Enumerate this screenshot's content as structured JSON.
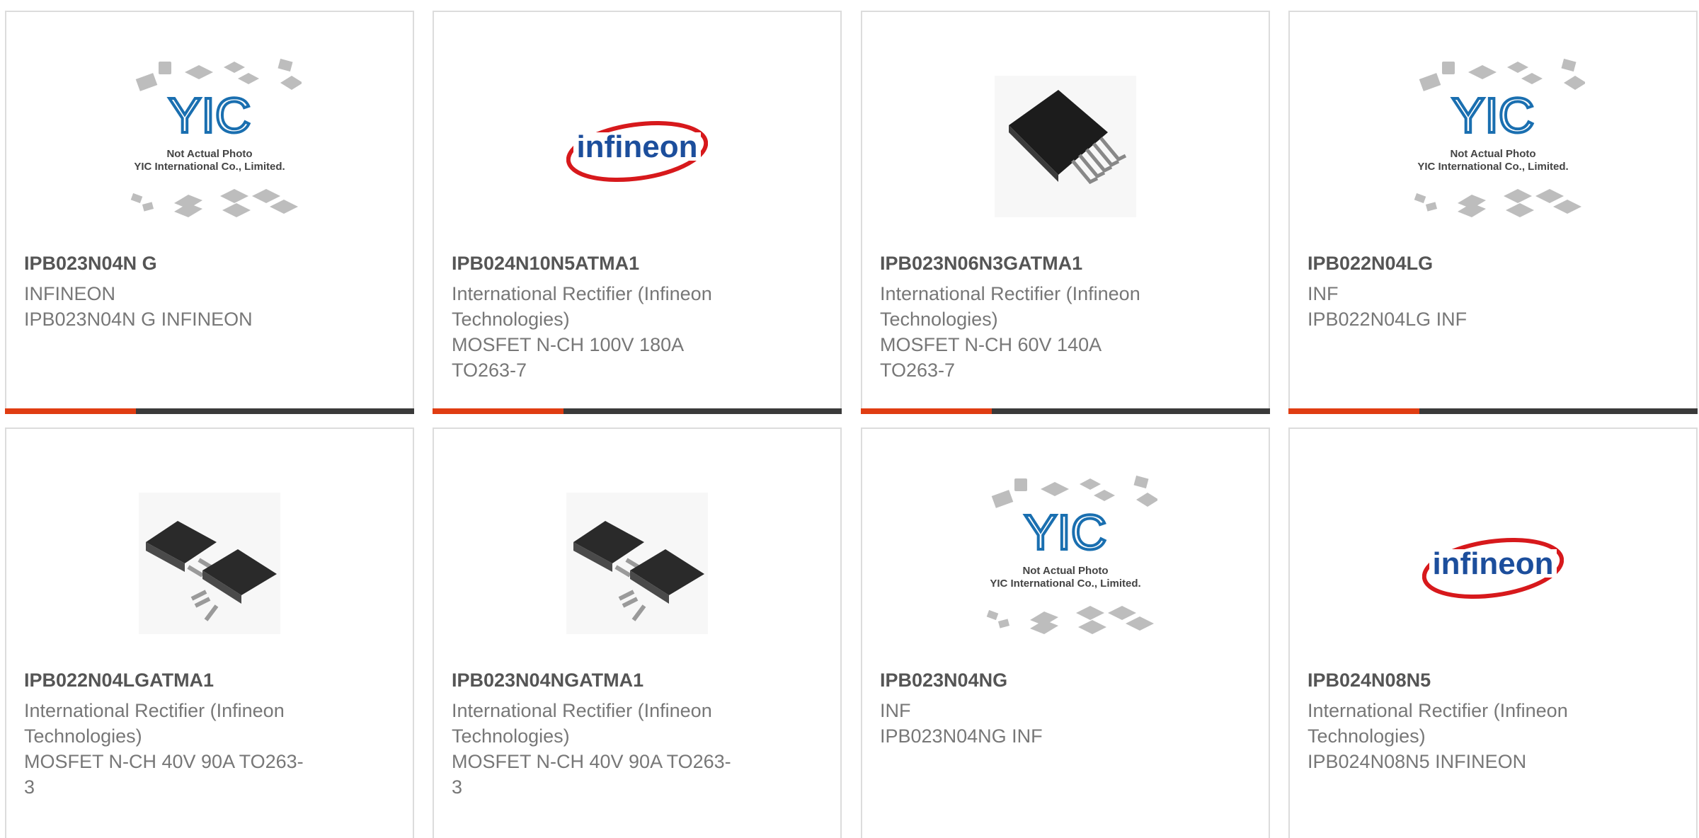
{
  "colors": {
    "accent": "#e03d12",
    "bar": "#3a3a3a",
    "title": "#555555",
    "text": "#777777",
    "border": "#dcdcdc"
  },
  "cards": [
    {
      "image": "yic-placeholder",
      "title": "IPB023N04N G",
      "lines": [
        "INFINEON",
        "IPB023N04N G INFINEON"
      ]
    },
    {
      "image": "infineon-logo",
      "title": "IPB024N10N5ATMA1",
      "lines": [
        "International Rectifier (Infineon",
        "Technologies)",
        "MOSFET N-CH 100V 180A",
        "TO263-7"
      ]
    },
    {
      "image": "to263-7-package-photo",
      "title": "IPB023N06N3GATMA1",
      "lines": [
        "International Rectifier (Infineon",
        "Technologies)",
        "MOSFET N-CH 60V 140A",
        "TO263-7"
      ]
    },
    {
      "image": "yic-placeholder",
      "title": "IPB022N04LG",
      "lines": [
        "INF",
        "IPB022N04LG INF"
      ]
    },
    {
      "image": "to263-3-package-photo",
      "title": "IPB022N04LGATMA1",
      "lines": [
        "International Rectifier (Infineon",
        "Technologies)",
        "MOSFET N-CH 40V 90A TO263-",
        "3"
      ]
    },
    {
      "image": "to263-3-package-photo",
      "title": "IPB023N04NGATMA1",
      "lines": [
        "International Rectifier (Infineon",
        "Technologies)",
        "MOSFET N-CH 40V 90A TO263-",
        "3"
      ]
    },
    {
      "image": "yic-placeholder",
      "title": "IPB023N04NG",
      "lines": [
        "INF",
        "IPB023N04NG INF"
      ]
    },
    {
      "image": "infineon-logo",
      "title": "IPB024N08N5",
      "lines": [
        "International Rectifier (Infineon",
        "Technologies)",
        "IPB024N08N5 INFINEON"
      ]
    }
  ],
  "yic_caption": [
    "Not Actual Photo",
    "YIC International Co., Limited."
  ],
  "logo_text": "infineon",
  "yic_text": "YIC"
}
